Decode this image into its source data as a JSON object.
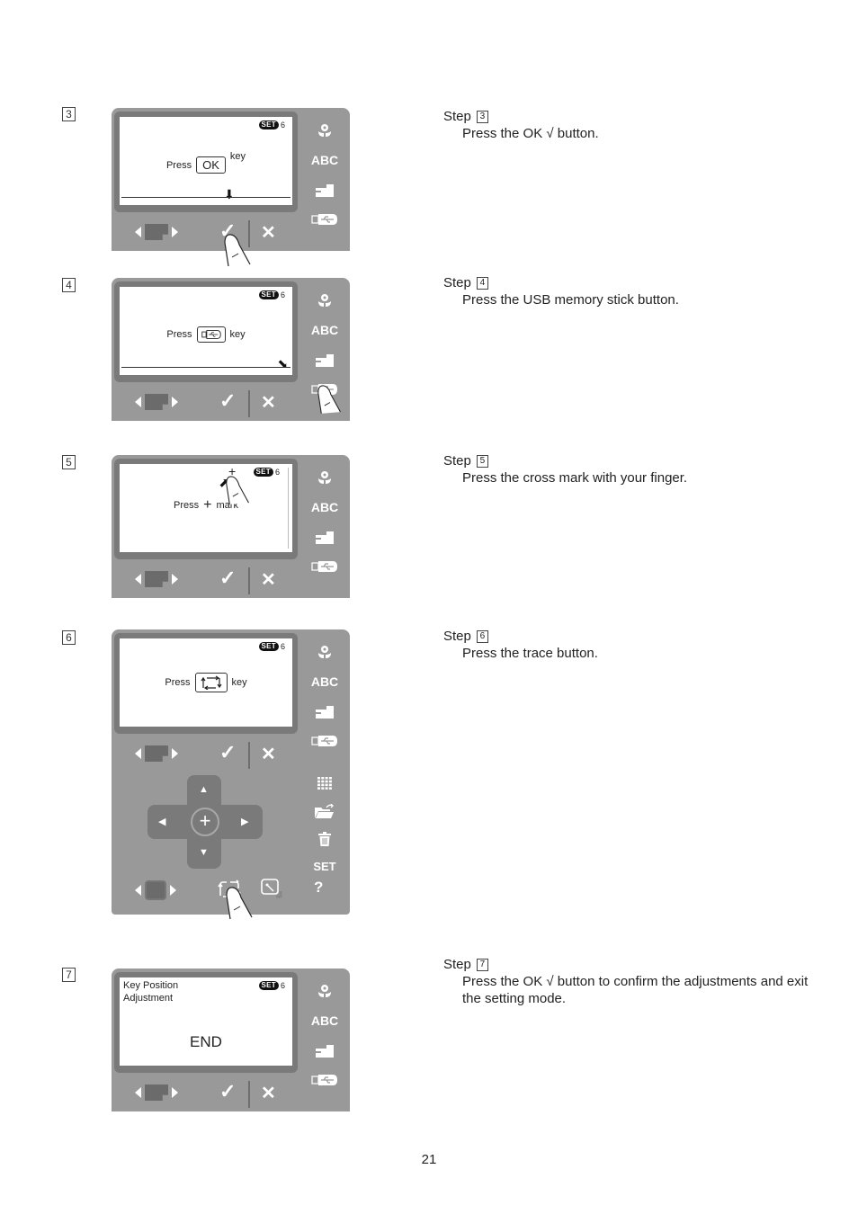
{
  "steps": [
    {
      "number": "3",
      "screen": {
        "badge": "SET",
        "badge_num": "6",
        "press": "Press",
        "key_label": "OK",
        "key_suffix": "key"
      },
      "panel": {
        "side": [
          "flower-icon",
          "ABC",
          "sewing-machine-icon",
          "usb-icon"
        ]
      },
      "label": "Step",
      "text": "Press the OK √ button."
    },
    {
      "number": "4",
      "screen": {
        "badge": "SET",
        "badge_num": "6",
        "press": "Press",
        "key_suffix": "key"
      },
      "label": "Step",
      "text": "Press the USB memory stick button."
    },
    {
      "number": "5",
      "screen": {
        "badge": "SET",
        "badge_num": "6",
        "press": "Press",
        "mark_suffix": "mark"
      },
      "label": "Step",
      "text": "Press the cross mark with your finger."
    },
    {
      "number": "6",
      "screen": {
        "badge": "SET",
        "badge_num": "6",
        "press": "Press",
        "key_suffix": "key"
      },
      "lower_side": [
        "grid-icon",
        "folder-icon",
        "trash-icon",
        "SET"
      ],
      "help": "?",
      "label": "Step",
      "text": "Press the trace button."
    },
    {
      "number": "7",
      "screen": {
        "badge": "SET",
        "badge_num": "6",
        "title_line1": "Key Position",
        "title_line2": "Adjustment",
        "end": "END"
      },
      "label": "Step",
      "text": "Press the OK √ button to confirm the adjustments and exit the setting mode."
    }
  ],
  "side_abc": "ABC",
  "ok_symbol": "✓",
  "x_symbol": "✕",
  "page_number": "21"
}
